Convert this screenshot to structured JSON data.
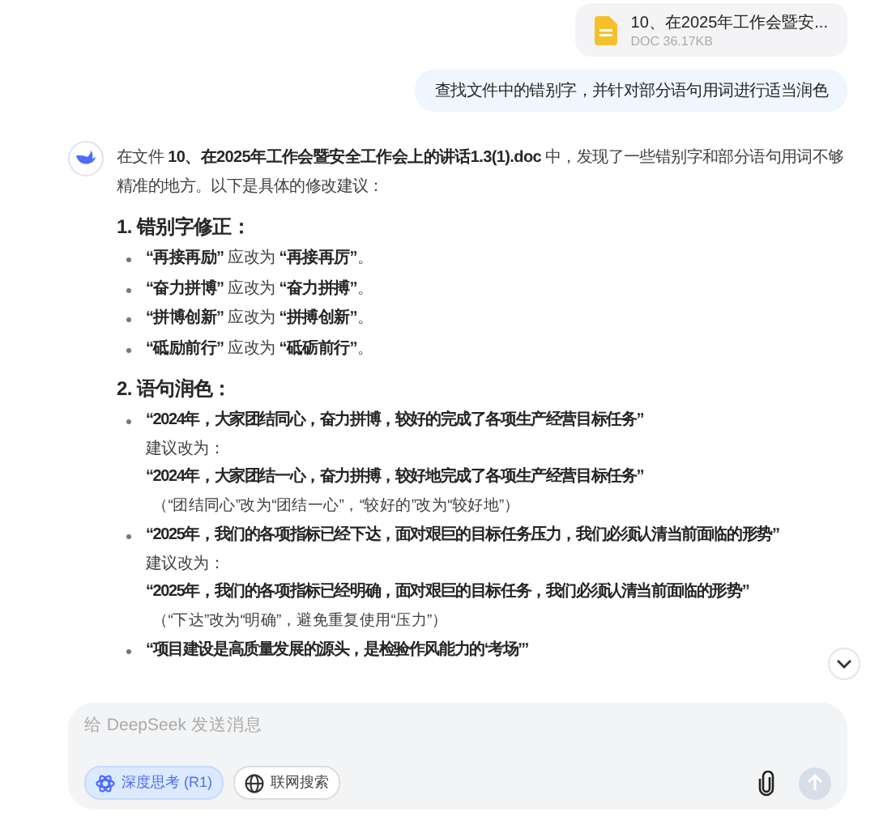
{
  "attachment": {
    "name": "10、在2025年工作会暨安...",
    "meta": "DOC 36.17KB"
  },
  "user_message": "查找文件中的错别字，并针对部分语句用词进行适当润色",
  "assistant": {
    "intro": "在文件 **10、在2025年工作会暨安全工作会上的讲话1.3(1).doc** 中，发现了一些错别字和部分语句用词不够精准的地方。以下是具体的修改建议：",
    "sections": [
      {
        "heading": "1. 错别字修正：",
        "items": [
          {
            "kind": "correction",
            "text": "**“再接再励”** 应改为 **“再接再厉”**。"
          },
          {
            "kind": "correction",
            "text": "**“奋力拼博”** 应改为 **“奋力拼搏”**。"
          },
          {
            "kind": "correction",
            "text": "**“拼博创新”** 应改为 **“拼搏创新”**。"
          },
          {
            "kind": "correction",
            "text": "**“砥励前行”** 应改为 **“砥砺前行”**。"
          }
        ]
      },
      {
        "heading": "2. 语句润色：",
        "items": [
          {
            "kind": "rewrite",
            "original": "“2024年，大家团结同心，奋力拼博，较好的完成了各项生产经营目标任务”",
            "label": "建议改为：",
            "revised": "“2024年，大家团结一心，奋力拼搏，较好地完成了各项生产经营目标任务”",
            "note": "（“团结同心”改为“团结一心”，“较好的”改为“较好地”）"
          },
          {
            "kind": "rewrite",
            "original": "“2025年，我们的各项指标已经下达，面对艰巨的目标任务压力，我们必须认清当前面临的形势”",
            "label": "建议改为：",
            "revised": "“2025年，我们的各项指标已经明确，面对艰巨的目标任务，我们必须认清当前面临的形势”",
            "note": "（“下达”改为“明确”，避免重复使用“压力”）"
          },
          {
            "kind": "rewrite",
            "original": "“项目建设是高质量发展的源头，是检验作风能力的‘考场’”"
          }
        ]
      }
    ]
  },
  "composer": {
    "placeholder": "给 DeepSeek 发送消息",
    "toggles": [
      {
        "label": "深度思考 (R1)",
        "selected": true
      },
      {
        "label": "联网搜索",
        "selected": false
      }
    ]
  }
}
